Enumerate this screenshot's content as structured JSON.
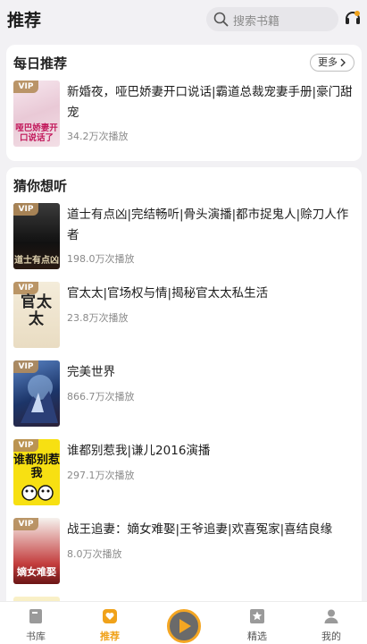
{
  "header": {
    "title": "推荐",
    "search_placeholder": "搜索书籍"
  },
  "daily": {
    "title": "每日推荐",
    "more_label": "更多",
    "books": [
      {
        "vip": "VIP",
        "cover_text": "哑巴娇妻开口说话了",
        "title": "新婚夜，哑巴娇妻开口说话|霸道总裁宠妻手册|豪门甜宠",
        "plays": "34.2万次播放"
      }
    ]
  },
  "guess": {
    "title": "猜你想听",
    "books": [
      {
        "vip": "VIP",
        "cover_text": "道士有点凶",
        "title": "道士有点凶|完结畅听|骨头演播|都市捉鬼人|赊刀人作者",
        "plays": "198.0万次播放"
      },
      {
        "vip": "VIP",
        "cover_text": "官太太",
        "title": "官太太|官场权与情|揭秘官太太私生活",
        "plays": "23.8万次播放"
      },
      {
        "vip": "VIP",
        "cover_text": "",
        "title": "完美世界",
        "plays": "866.7万次播放"
      },
      {
        "vip": "VIP",
        "cover_text": "谁都别惹我",
        "title": "谁都别惹我|谦儿2016演播",
        "plays": "297.1万次播放"
      },
      {
        "vip": "VIP",
        "cover_text": "嫡女难娶",
        "title": "战王追妻：嫡女难娶|王爷追妻|欢喜冤家|喜结良缘",
        "plays": "8.0万次播放"
      }
    ]
  },
  "bottom_nav": {
    "items": [
      {
        "label": "书库",
        "icon": "book-icon",
        "active": false
      },
      {
        "label": "推荐",
        "icon": "recommend-icon",
        "active": true
      },
      {
        "label": "精选",
        "icon": "star-icon",
        "active": false
      },
      {
        "label": "我的",
        "icon": "user-icon",
        "active": false
      }
    ],
    "center_icon": "play-icon"
  },
  "colors": {
    "accent": "#f0a21a",
    "background": "#f2f1f4",
    "vip_tag": "#b48c5a"
  }
}
